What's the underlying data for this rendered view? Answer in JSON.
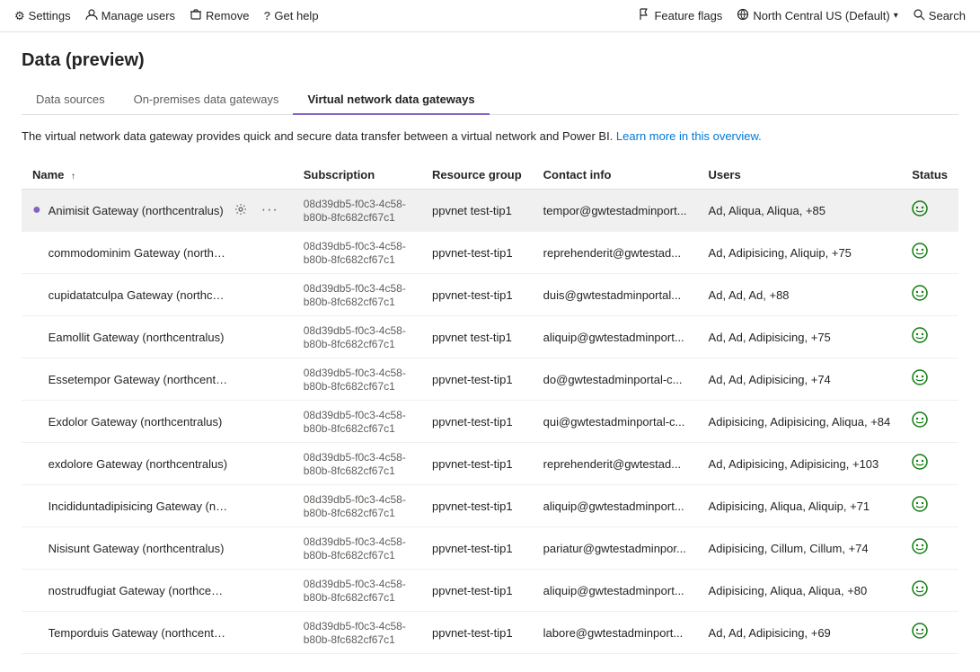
{
  "topbar": {
    "settings_label": "Settings",
    "manage_users_label": "Manage users",
    "remove_label": "Remove",
    "get_help_label": "Get help",
    "feature_flags_label": "Feature flags",
    "region_label": "North Central US (Default)",
    "search_placeholder": "Search"
  },
  "page": {
    "title": "Data (preview)",
    "info_text": "The virtual network data gateway provides quick and secure data transfer between a virtual network and Power BI.",
    "info_link_text": "Learn more in this overview.",
    "info_link_url": "#"
  },
  "tabs": [
    {
      "id": "data-sources",
      "label": "Data sources"
    },
    {
      "id": "on-premises",
      "label": "On-premises data gateways"
    },
    {
      "id": "vnet",
      "label": "Virtual network data gateways",
      "active": true
    }
  ],
  "table": {
    "columns": [
      {
        "id": "name",
        "label": "Name",
        "sortable": true,
        "sort_arrow": "↑"
      },
      {
        "id": "subscription",
        "label": "Subscription",
        "sortable": false
      },
      {
        "id": "resource_group",
        "label": "Resource group",
        "sortable": false
      },
      {
        "id": "contact_info",
        "label": "Contact info",
        "sortable": false
      },
      {
        "id": "users",
        "label": "Users",
        "sortable": false
      },
      {
        "id": "status",
        "label": "Status",
        "sortable": false
      }
    ],
    "rows": [
      {
        "name": "Animisit Gateway (northcentralus)",
        "selected": true,
        "subscription": "08d39db5-f0c3-4c58-b80b-8fc682cf67c1",
        "resource_group": "ppvnet test-tip1",
        "contact_info": "tempor@gwtestadminport...",
        "users": "Ad, Aliqua, Aliqua, +85",
        "status": "ok"
      },
      {
        "name": "commodominim Gateway (northcentra...",
        "selected": false,
        "subscription": "08d39db5-f0c3-4c58-b80b-8fc682cf67c1",
        "resource_group": "ppvnet-test-tip1",
        "contact_info": "reprehenderit@gwtestad...",
        "users": "Ad, Adipisicing, Aliquip, +75",
        "status": "ok"
      },
      {
        "name": "cupidatatculpa Gateway (northcentralus)",
        "selected": false,
        "subscription": "08d39db5-f0c3-4c58-b80b-8fc682cf67c1",
        "resource_group": "ppvnet-test-tip1",
        "contact_info": "duis@gwtestadminportal...",
        "users": "Ad, Ad, Ad, +88",
        "status": "ok"
      },
      {
        "name": "Eamollit Gateway (northcentralus)",
        "selected": false,
        "subscription": "08d39db5-f0c3-4c58-b80b-8fc682cf67c1",
        "resource_group": "ppvnet test-tip1",
        "contact_info": "aliquip@gwtestadminport...",
        "users": "Ad, Ad, Adipisicing, +75",
        "status": "ok"
      },
      {
        "name": "Essetempor Gateway (northcentralus)",
        "selected": false,
        "subscription": "08d39db5-f0c3-4c58-b80b-8fc682cf67c1",
        "resource_group": "ppvnet-test-tip1",
        "contact_info": "do@gwtestadminportal-c...",
        "users": "Ad, Ad, Adipisicing, +74",
        "status": "ok"
      },
      {
        "name": "Exdolor Gateway (northcentralus)",
        "selected": false,
        "subscription": "08d39db5-f0c3-4c58-b80b-8fc682cf67c1",
        "resource_group": "ppvnet-test-tip1",
        "contact_info": "qui@gwtestadminportal-c...",
        "users": "Adipisicing, Adipisicing, Aliqua, +84",
        "status": "ok"
      },
      {
        "name": "exdolore Gateway (northcentralus)",
        "selected": false,
        "subscription": "08d39db5-f0c3-4c58-b80b-8fc682cf67c1",
        "resource_group": "ppvnet-test-tip1",
        "contact_info": "reprehenderit@gwtestad...",
        "users": "Ad, Adipisicing, Adipisicing, +103",
        "status": "ok"
      },
      {
        "name": "Incididuntadipisicing Gateway (northc...",
        "selected": false,
        "subscription": "08d39db5-f0c3-4c58-b80b-8fc682cf67c1",
        "resource_group": "ppvnet-test-tip1",
        "contact_info": "aliquip@gwtestadminport...",
        "users": "Adipisicing, Aliqua, Aliquip, +71",
        "status": "ok"
      },
      {
        "name": "Nisisunt Gateway (northcentralus)",
        "selected": false,
        "subscription": "08d39db5-f0c3-4c58-b80b-8fc682cf67c1",
        "resource_group": "ppvnet-test-tip1",
        "contact_info": "pariatur@gwtestadminpor...",
        "users": "Adipisicing, Cillum, Cillum, +74",
        "status": "ok"
      },
      {
        "name": "nostrudfugiat Gateway (northcentralus)",
        "selected": false,
        "subscription": "08d39db5-f0c3-4c58-b80b-8fc682cf67c1",
        "resource_group": "ppvnet-test-tip1",
        "contact_info": "aliquip@gwtestadminport...",
        "users": "Adipisicing, Aliqua, Aliqua, +80",
        "status": "ok"
      },
      {
        "name": "Temporduis Gateway (northcentralus)",
        "selected": false,
        "subscription": "08d39db5-f0c3-4c58-b80b-8fc682cf67c1",
        "resource_group": "ppvnet-test-tip1",
        "contact_info": "labore@gwtestadminport...",
        "users": "Ad, Ad, Adipisicing, +69",
        "status": "ok"
      }
    ]
  },
  "icons": {
    "settings": "⚙",
    "manage_users": "👤",
    "remove": "🗑",
    "get_help": "?",
    "feature_flags": "⚑",
    "region": "🌐",
    "search": "🔍",
    "sort_asc": "↑",
    "status_ok": "🙂",
    "gear": "⚙",
    "more": "..."
  }
}
